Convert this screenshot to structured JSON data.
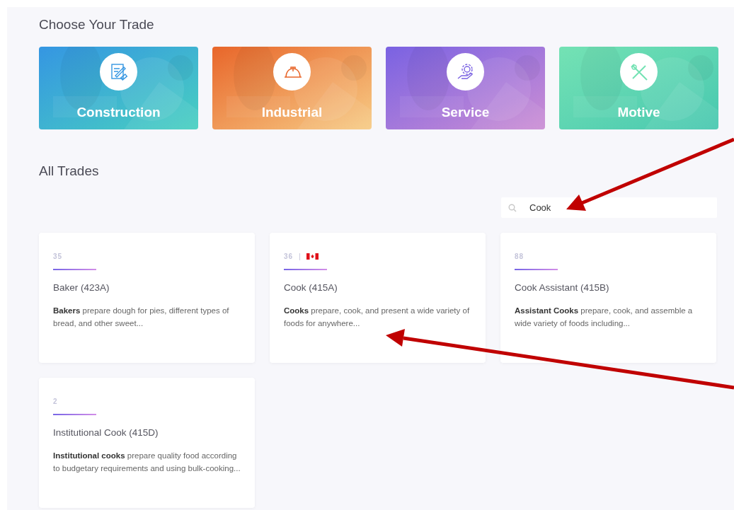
{
  "heading": "Choose Your Trade",
  "trades": [
    {
      "label": "Construction",
      "kind": "blueprint"
    },
    {
      "label": "Industrial",
      "kind": "hardhat"
    },
    {
      "label": "Service",
      "kind": "service"
    },
    {
      "label": "Motive",
      "kind": "tools"
    }
  ],
  "all_heading": "All Trades",
  "search": {
    "value": "Cook"
  },
  "cards": [
    {
      "number": "35",
      "flag": false,
      "title": "Baker (423A)",
      "description": "**Bakers** prepare dough for pies, different types of bread, and other sweet..."
    },
    {
      "number": "36",
      "flag": true,
      "separator": "|",
      "title": "Cook (415A)",
      "description": "**Cooks** prepare, cook, and present a wide variety of foods for anywhere..."
    },
    {
      "number": "88",
      "flag": false,
      "title": "Cook Assistant (415B)",
      "description": "**Assistant Cooks** prepare, cook, and assemble a wide variety of foods including..."
    },
    {
      "number": "2",
      "flag": false,
      "title": "Institutional Cook (415D)",
      "description": "**Institutional cooks** prepare quality food according to budgetary requirements and using bulk-cooking..."
    }
  ]
}
